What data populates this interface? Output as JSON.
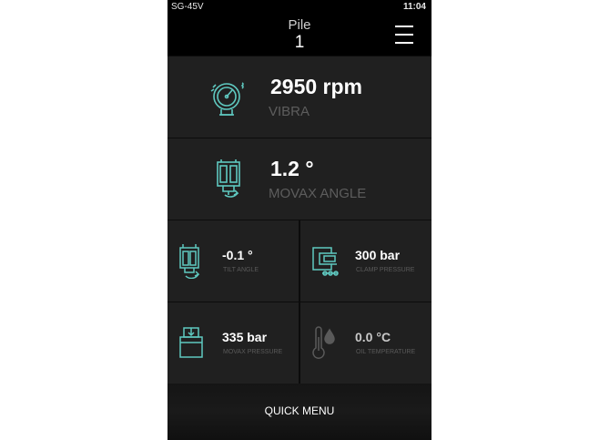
{
  "statusbar": {
    "device": "SG-45V",
    "time": "11:04"
  },
  "header": {
    "title": "Pile",
    "pile_number": "1"
  },
  "tiles": {
    "vibra": {
      "value": "2950 rpm",
      "label": "VIBRA",
      "icon": "vibration-gauge-icon"
    },
    "movax_angle": {
      "value": "1.2 °",
      "label": "MOVAX ANGLE",
      "icon": "movax-angle-icon"
    },
    "tilt_angle": {
      "value": "-0.1 °",
      "label": "TILT ANGLE",
      "icon": "tilt-angle-icon"
    },
    "clamp_pressure": {
      "value": "300 bar",
      "label": "CLAMP PRESSURE",
      "icon": "clamp-icon"
    },
    "movax_pressure": {
      "value": "335 bar",
      "label": "MOVAX PRESSURE",
      "icon": "movax-pressure-icon"
    },
    "oil_temperature": {
      "value": "0.0 °C",
      "label": "OIL TEMPERATURE",
      "icon": "thermometer-icon"
    }
  },
  "footer": {
    "quick_menu_label": "QUICK MENU"
  },
  "colors": {
    "accent": "#5fc9c0",
    "background": "#1e1e1e",
    "muted": "#5d5d5d"
  }
}
